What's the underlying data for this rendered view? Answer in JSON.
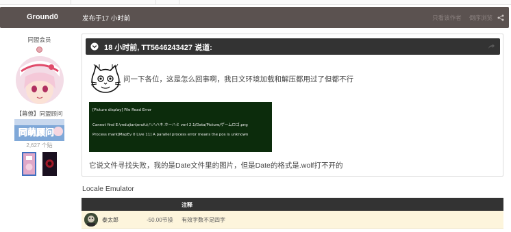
{
  "post": {
    "author": "Ground0",
    "time": "发布于17 小时前",
    "header_links": [
      "只看该作者",
      "倒序浏览"
    ]
  },
  "author_panel": {
    "group": "同盟会员",
    "rank_title": "【幕僚】同盟顾问",
    "banner_text": "同萌顾问",
    "post_count": "2,627 个贴"
  },
  "quote": {
    "title": "18 小时前, TT5646243427 说道:",
    "question": "问一下各位，这是怎么回事啊，我日文环境加载和解压都用过了但都不行",
    "error_lines": [
      "[Picture display] File Read Error",
      "Cannot find  E:\\mdujian\\erufu\\ハハハキ.ホーハミ verl 2.1/Data/Picture/ゲームロゴ.png",
      "Process mark[MapEv 0 Live 11] A parallel process error means the pos is unknown"
    ],
    "description": "它说文件寻找失败，我的是Date文件里的图片，但是Date的格式是.wolf打不开的"
  },
  "signature": "Locale Emulator",
  "ratings": {
    "header_note": "注释",
    "rows": [
      {
        "user": "泰太郎",
        "score": "-50.00节操",
        "note": "有效字数不足四字"
      }
    ]
  },
  "colors": {
    "header_bg": "#5b5250",
    "quote_bar_bg": "#333333",
    "error_bg": "#0c2c0c",
    "rating_row_bg": "#fdf5dc"
  }
}
